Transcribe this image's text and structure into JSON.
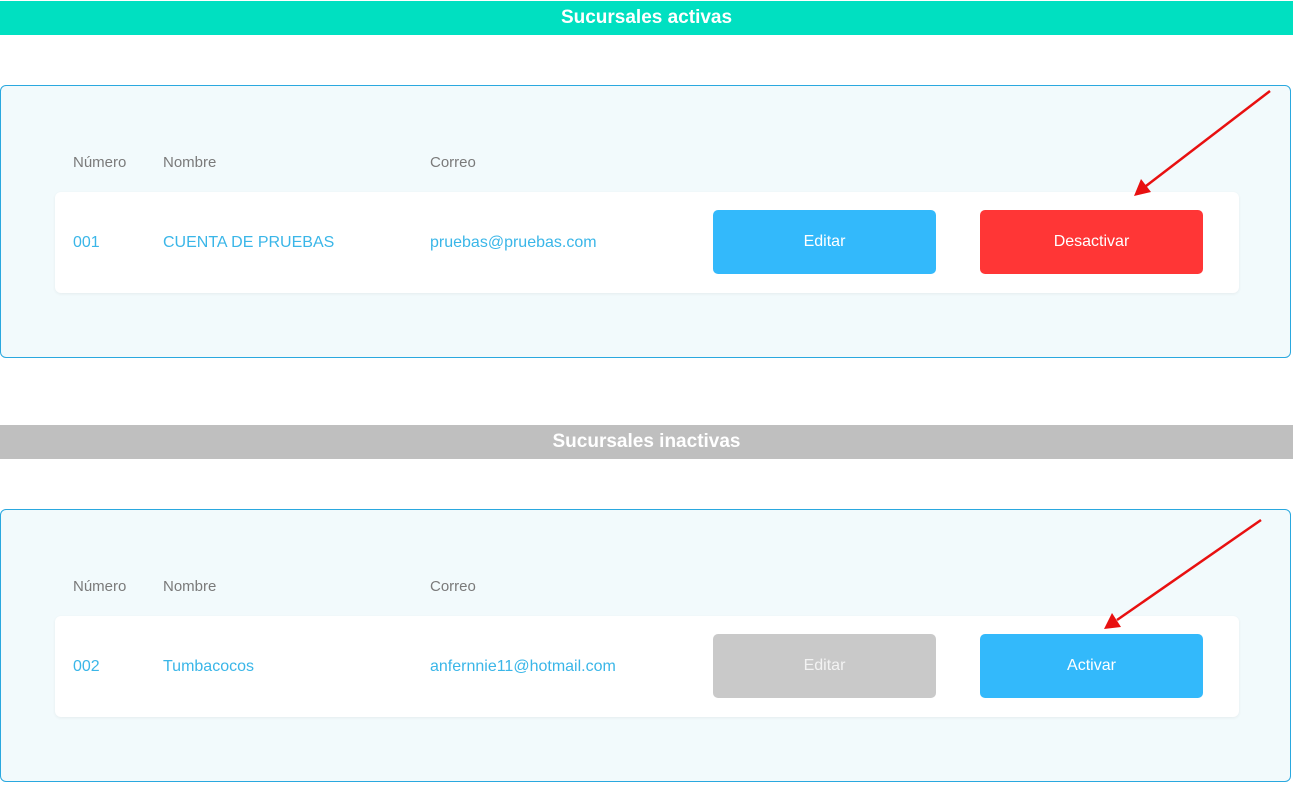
{
  "active_section": {
    "title": "Sucursales activas",
    "columns": {
      "number": "Número",
      "name": "Nombre",
      "email": "Correo"
    },
    "rows": [
      {
        "number": "001",
        "name": "CUENTA DE PRUEBAS",
        "email": "pruebas@pruebas.com",
        "edit_label": "Editar",
        "action_label": "Desactivar"
      }
    ]
  },
  "inactive_section": {
    "title": "Sucursales inactivas",
    "columns": {
      "number": "Número",
      "name": "Nombre",
      "email": "Correo"
    },
    "rows": [
      {
        "number": "002",
        "name": "Tumbacocos",
        "email": "anfernnie11@hotmail.com",
        "edit_label": "Editar",
        "action_label": "Activar"
      }
    ]
  },
  "colors": {
    "active_header": "#00e0c1",
    "inactive_header": "#bfbfbf",
    "primary_button": "#33b9fb",
    "danger_button": "#ff3636",
    "disabled_button": "#c9c9c9",
    "link_text": "#3ab6e8",
    "annotation_arrow": "#e81010"
  },
  "annotations": [
    {
      "icon": "annotation-arrow-icon",
      "points_to": "deactivate-button"
    },
    {
      "icon": "annotation-arrow-icon",
      "points_to": "activate-button"
    }
  ]
}
